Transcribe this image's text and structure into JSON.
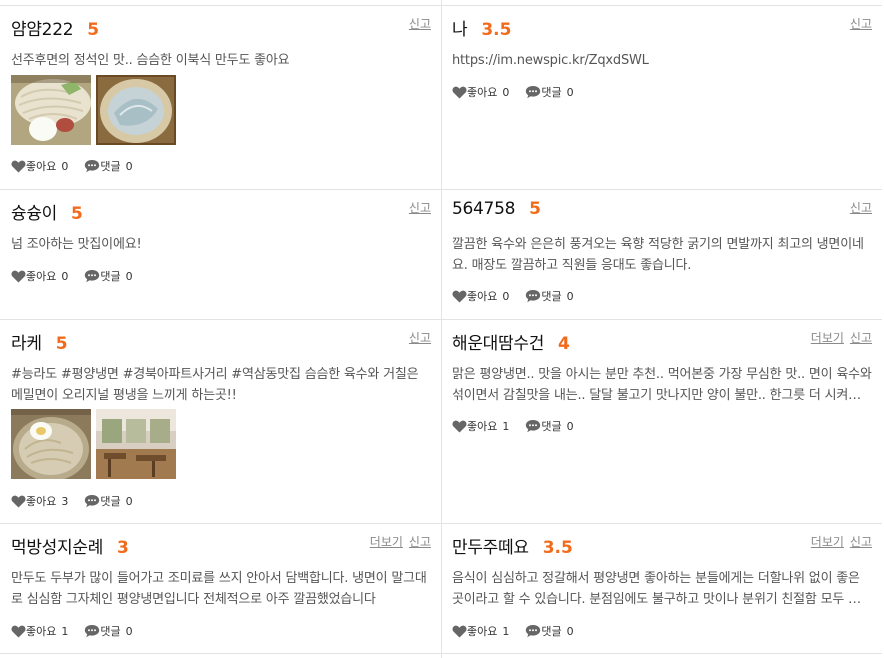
{
  "labels": {
    "report": "신고",
    "more": "더보기",
    "like": "좋아요",
    "comment": "댓글"
  },
  "colors": {
    "score": "#f26b1d",
    "border": "#e3e3e3",
    "icon": "#666666"
  },
  "reviews": [
    {
      "user": "얌얌222",
      "score": "5",
      "text": "선주후면의 정석인 맛.. 슴슴한 이북식 만두도 좋아요",
      "likes": "0",
      "comments": "0",
      "photos": [
        "noodle-egg-photo",
        "dumpling-photo"
      ]
    },
    {
      "user": "나",
      "score": "3.5",
      "text": "https://im.newspic.kr/ZqxdSWL",
      "likes": "0",
      "comments": "0"
    },
    {
      "user": "슝슝이",
      "score": "5",
      "text": "넘 조아하는 맛집이에요!",
      "likes": "0",
      "comments": "0"
    },
    {
      "user": "564758",
      "score": "5",
      "text": "깔끔한 육수와 은은히 풍겨오는 육향 적당한 굵기의 면발까지 최고의 냉면이네요. 매장도 깔끔하고 직원들 응대도 좋습니다.",
      "likes": "0",
      "comments": "0"
    },
    {
      "user": "라케",
      "score": "5",
      "text": "#능라도 #평양냉면 #경북아파트사거리 #역삼동맛집 슴슴한 육수와 거칠은 메밀면이 오리지널 평냉을 느끼게 하는곳!!",
      "likes": "3",
      "comments": "0",
      "photos": [
        "cold-noodle-photo",
        "restaurant-interior-photo"
      ]
    },
    {
      "user": "해운대땀수건",
      "score": "4",
      "text": "맑은 평양냉면.. 맛을 아시는 분만 추천.. 먹어본중 가장 무심한 맛.. 면이 육수와 섞이면서 감칠맛을 내는.. 달달 불고기 맛나지만 양이 불만.. 한그릇 더 시켜먹었습니다",
      "likes": "1",
      "comments": "0",
      "has_more": true
    },
    {
      "user": "먹방성지순례",
      "score": "3",
      "text": "만두도 두부가 많이 들어가고 조미료를 쓰지 안아서 담백합니다. 냉면이 말그대로 심심함 그자체인 평양냉면입니다 전체적으로 아주 깔끔했었습니다",
      "likes": "1",
      "comments": "0",
      "has_more": true
    },
    {
      "user": "만두주떼요",
      "score": "3.5",
      "text": "음식이 심심하고 정갈해서 평양냉면 좋아하는 분들에게는 더할나위 없이 좋은 곳이라고 할 수 있습니다. 분점임에도 불구하고 맛이나 분위기 친절함 모두 좋았습니다",
      "likes": "1",
      "comments": "0",
      "has_more": true
    }
  ]
}
